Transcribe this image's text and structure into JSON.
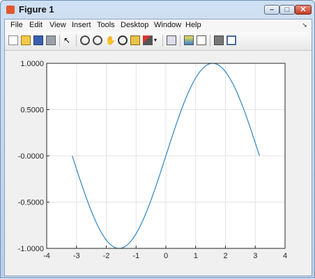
{
  "window": {
    "title": "Figure 1"
  },
  "menu": {
    "items": [
      "File",
      "Edit",
      "View",
      "Insert",
      "Tools",
      "Desktop",
      "Window",
      "Help"
    ]
  },
  "toolbar": {
    "icons": [
      "new-figure-icon",
      "open-file-icon",
      "save-icon",
      "print-icon",
      "edit-plot-icon",
      "zoom-in-icon",
      "zoom-out-icon",
      "pan-icon",
      "rotate-icon",
      "data-cursor-icon",
      "brush-icon",
      "brush-dropdown-icon",
      "link-plot-icon",
      "colorbar-icon",
      "legend-icon",
      "hide-plot-tools-icon",
      "show-plot-tools-icon"
    ]
  },
  "colors": {
    "line": "#2e86c1",
    "axes_bg": "#ffffff",
    "figure_bg": "#f0f0f0"
  },
  "chart_data": {
    "type": "line",
    "title": "",
    "xlabel": "",
    "ylabel": "",
    "xlim": [
      -4,
      4
    ],
    "ylim": [
      -1,
      1
    ],
    "grid": true,
    "xticks": [
      "-4",
      "-3",
      "-2",
      "-1",
      "0",
      "1",
      "2",
      "3",
      "4"
    ],
    "yticks": [
      "1.0000",
      "0.5000",
      "-0.0000",
      "-0.5000",
      "-1.0000"
    ],
    "series": [
      {
        "function": "sin(x)",
        "x_range": [
          -3.1416,
          3.1416
        ]
      }
    ]
  }
}
